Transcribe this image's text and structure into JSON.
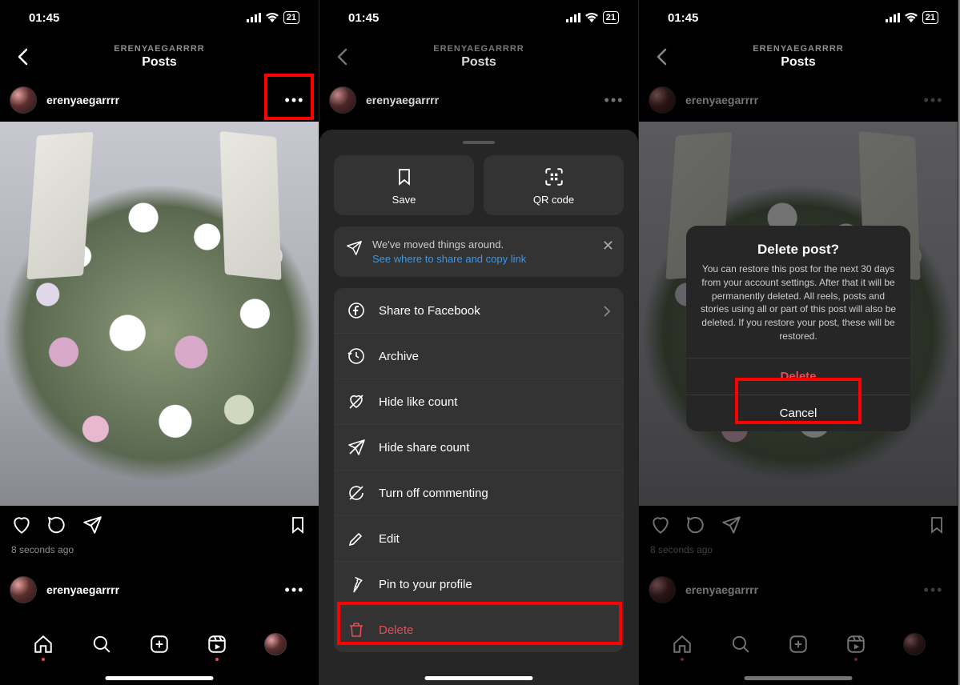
{
  "status": {
    "time": "01:45",
    "battery": "21"
  },
  "nav": {
    "username_upper": "ERENYAEGARRRR",
    "title": "Posts"
  },
  "post": {
    "username": "erenyaegarrrr",
    "timestamp": "8 seconds ago"
  },
  "sheet": {
    "save": "Save",
    "qr": "QR code",
    "banner_line1": "We've moved things around.",
    "banner_link": "See where to share and copy link",
    "items": {
      "share_fb": "Share to Facebook",
      "archive": "Archive",
      "hide_likes": "Hide like count",
      "hide_share": "Hide share count",
      "turn_off_commenting": "Turn off commenting",
      "edit": "Edit",
      "pin": "Pin to your profile",
      "delete": "Delete"
    }
  },
  "alert": {
    "title": "Delete post?",
    "body": "You can restore this post for the next 30 days from your account settings. After that it will be permanently deleted. All reels, posts and stories using all or part of this post will also be deleted. If you restore your post, these will be restored.",
    "delete": "Delete",
    "cancel": "Cancel"
  }
}
